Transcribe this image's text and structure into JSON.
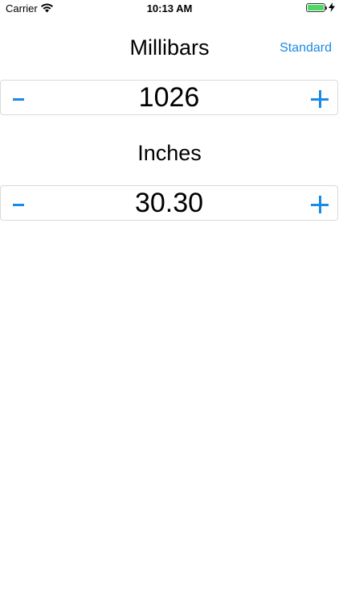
{
  "status_bar": {
    "carrier": "Carrier",
    "time": "10:13 AM",
    "battery_level": 1.0,
    "charging": true
  },
  "millibars": {
    "title": "Millibars",
    "value": "1026"
  },
  "inches": {
    "title": "Inches",
    "value": "30.30"
  },
  "nav": {
    "standard_label": "Standard"
  },
  "colors": {
    "accent": "#1a8ae6",
    "battery": "#4cd964"
  }
}
